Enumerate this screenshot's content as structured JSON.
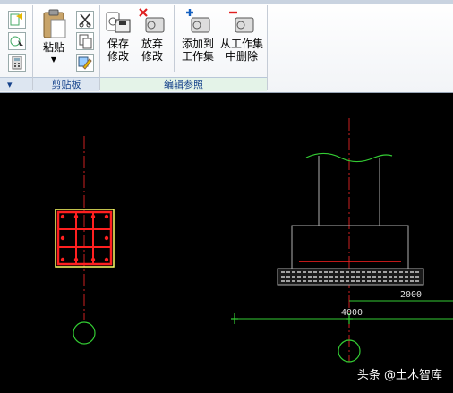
{
  "ribbon": {
    "clipboard_panel": {
      "label": "剪贴板",
      "paste_label": "粘贴"
    },
    "edit_panel": {
      "label": "编辑参照",
      "save_label_1": "保存",
      "save_label_2": "修改",
      "discard_label_1": "放弃",
      "discard_label_2": "修改",
      "add_label_1": "添加到",
      "add_label_2": "工作集",
      "remove_label_1": "从工作集",
      "remove_label_2": "中删除"
    }
  },
  "drawing": {
    "dim_2000": "2000",
    "dim_4000": "4000"
  },
  "watermark": "头条 @土木智库",
  "colors": {
    "canvas": "#000000",
    "rebar_red": "#ff2020",
    "highlight": "#ffff66",
    "green": "#33cc33",
    "gray_line": "#b0b0b0",
    "accent_blue": "#15428b"
  }
}
